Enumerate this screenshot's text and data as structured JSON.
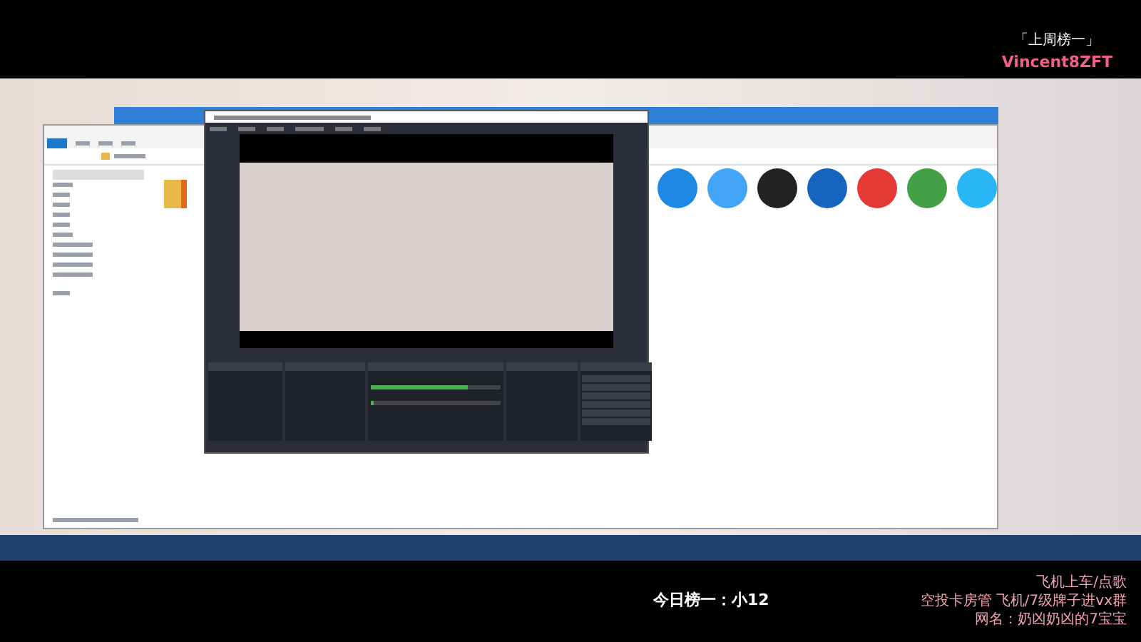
{
  "overlay": {
    "badge": "「上周榜一」",
    "streamer": "Vincent8ZFT",
    "top_fan": "今日榜一：小12",
    "notes": [
      "飞机上车/点歌",
      "空投卡房管 飞机/7级牌子进vx群"
    ],
    "nickname": "网名：奶凶奶凶的7宝宝"
  },
  "apps": [
    {
      "color": "#1e88e5"
    },
    {
      "color": "#42a5f5"
    },
    {
      "color": "#222222"
    },
    {
      "color": "#1565c0"
    },
    {
      "color": "#e53935"
    },
    {
      "color": "#43a047"
    },
    {
      "color": "#29b6f6"
    }
  ],
  "obs": {
    "mixer": [
      {
        "level": 0.75
      },
      {
        "level": 0.02
      }
    ]
  }
}
